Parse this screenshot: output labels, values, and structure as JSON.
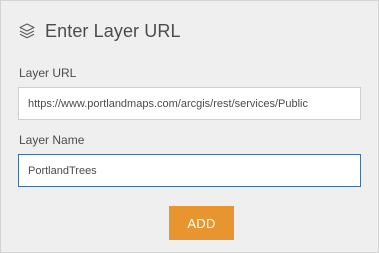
{
  "header": {
    "title": "Enter Layer URL",
    "icon": "layers-icon"
  },
  "form": {
    "url_label": "Layer URL",
    "url_value": "https://www.portlandmaps.com/arcgis/rest/services/Public",
    "name_label": "Layer Name",
    "name_value": "PortlandTrees",
    "add_label": "ADD"
  },
  "colors": {
    "panel_bg": "#efefef",
    "accent_button": "#e8952f",
    "focus_border": "#3f71a8",
    "text": "#4c4c4c"
  }
}
